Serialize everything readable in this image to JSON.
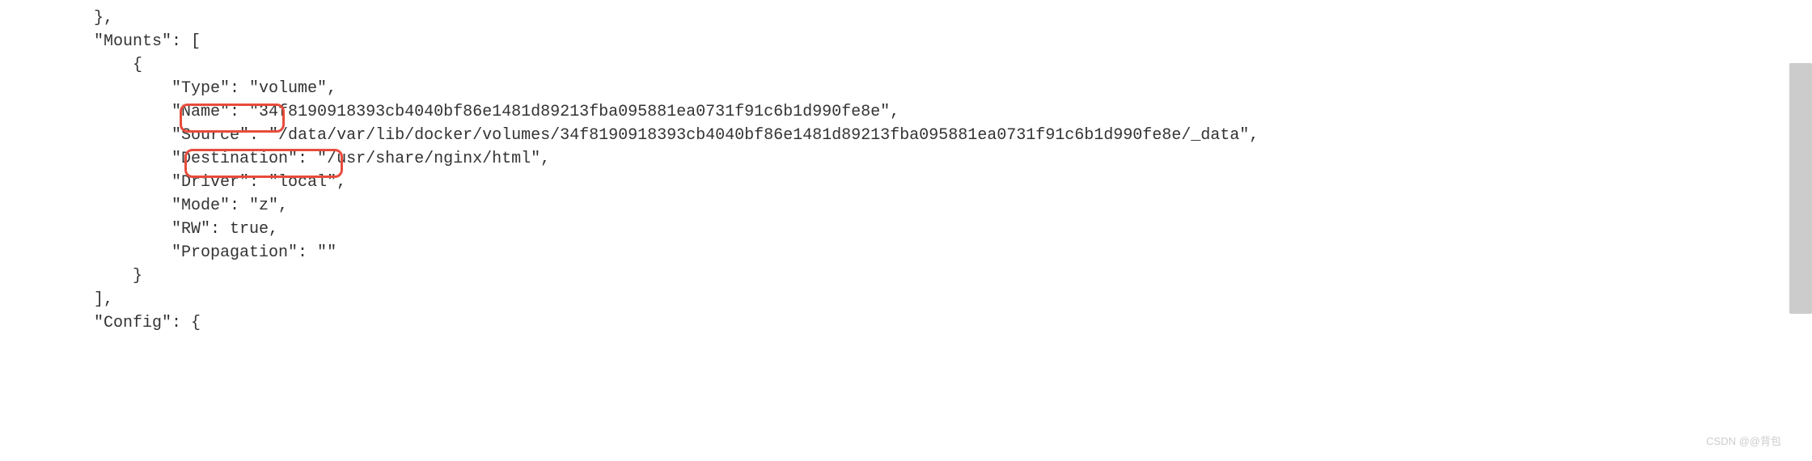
{
  "code": {
    "line1": "        },",
    "line2": "        \"Mounts\": [",
    "line3": "            {",
    "line4": "                \"Type\": \"volume\",",
    "line5": "                \"Name\": \"34f8190918393cb4040bf86e1481d89213fba095881ea0731f91c6b1d990fe8e\",",
    "line6": "                \"Source\": \"/data/var/lib/docker/volumes/34f8190918393cb4040bf86e1481d89213fba095881ea0731f91c6b1d990fe8e/_data\",",
    "line7": "                \"Destination\": \"/usr/share/nginx/html\",",
    "line8": "                \"Driver\": \"local\",",
    "line9": "                \"Mode\": \"z\",",
    "line10": "                \"RW\": true,",
    "line11": "                \"Propagation\": \"\"",
    "line12": "            }",
    "line13": "        ],",
    "line14": "        \"Config\": {"
  },
  "highlights": {
    "source_key": "\"Source\":",
    "destination_key": "\"Destination\":"
  },
  "watermark": "CSDN @@背包"
}
